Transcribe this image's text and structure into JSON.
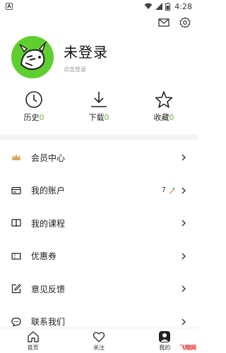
{
  "status_bar": {
    "left_badge": "A",
    "time": "4:28"
  },
  "profile": {
    "username": "未登录",
    "login_hint": "点击登录"
  },
  "stats": [
    {
      "label": "历史",
      "count": "0",
      "icon": "clock-icon"
    },
    {
      "label": "下载",
      "count": "0",
      "icon": "download-icon"
    },
    {
      "label": "收藏",
      "count": "0",
      "icon": "star-icon"
    }
  ],
  "menu": [
    {
      "label": "会员中心",
      "icon": "crown-icon"
    },
    {
      "label": "我的账户",
      "icon": "wallet-icon",
      "extra": "7"
    },
    {
      "label": "我的课程",
      "icon": "book-icon"
    },
    {
      "label": "优惠券",
      "icon": "coupon-icon"
    },
    {
      "label": "意见反馈",
      "icon": "edit-icon"
    },
    {
      "label": "联系我们",
      "icon": "chat-icon"
    }
  ],
  "bottom_nav": [
    {
      "label": "首页",
      "icon": "home-icon"
    },
    {
      "label": "关注",
      "icon": "heart-icon"
    },
    {
      "label": "我的",
      "icon": "person-icon",
      "active": true
    }
  ],
  "watermark": "飞翔网",
  "colors": {
    "accent_green": "#6ab847",
    "avatar_green": "#5fcf30",
    "crown_gold": "#d4a85a",
    "carrot_orange": "#f08a2c"
  }
}
